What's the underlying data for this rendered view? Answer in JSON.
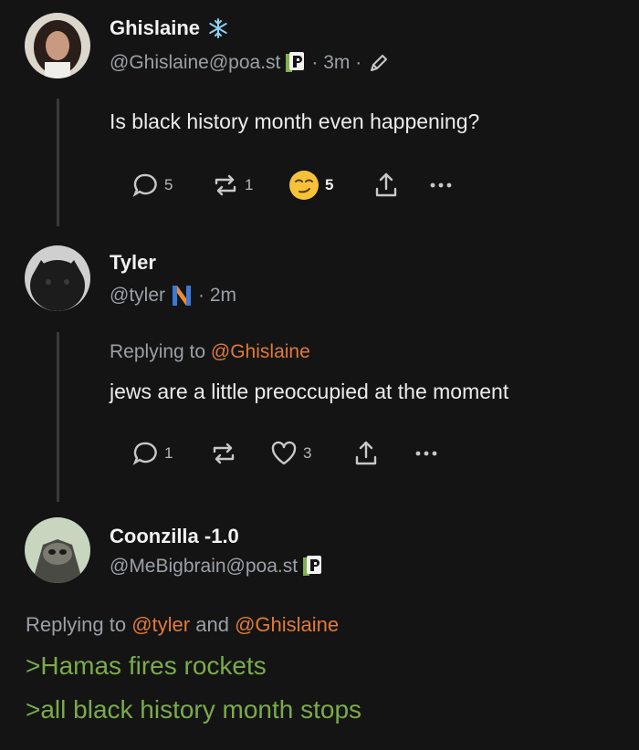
{
  "posts": [
    {
      "name": "Ghislaine",
      "handle": "@Ghislaine@poa.st",
      "time": "· 3m ·",
      "text": "Is black history month even happening?",
      "actions": {
        "replies": "5",
        "reposts": "1",
        "reactions": "5"
      }
    },
    {
      "name": "Tyler",
      "handle": "@tyler",
      "time": "· 2m",
      "replying_label": "Replying to",
      "replying_to": "@Ghislaine",
      "text": "jews are a little preoccupied at the moment",
      "actions": {
        "replies": "1",
        "likes": "3"
      }
    },
    {
      "name": "Coonzilla -1.0",
      "handle": "@MeBigbrain@poa.st",
      "replying_label": "Replying to",
      "replying_to_1": "@tyler",
      "and_word": "and",
      "replying_to_2": "@Ghislaine",
      "lines": [
        ">Hamas fires rockets",
        ">all black history month stops"
      ]
    }
  ],
  "colors": {
    "mention": "#e07a3a",
    "greentext": "#7aab4a",
    "background": "#141414"
  }
}
